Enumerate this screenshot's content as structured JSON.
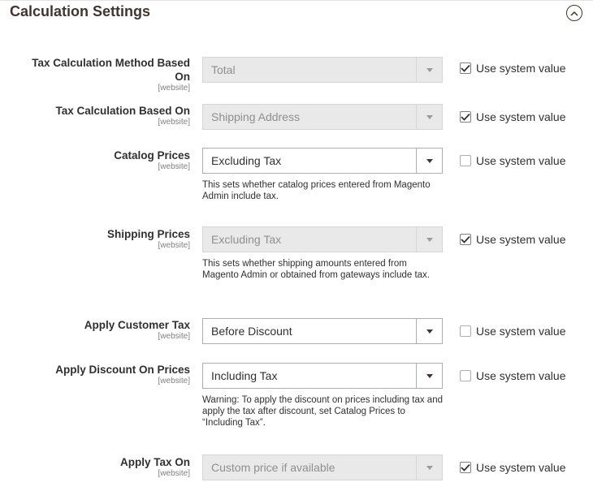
{
  "section": {
    "title": "Calculation Settings"
  },
  "use_system_value_label": "Use system value",
  "fields": [
    {
      "label": "Tax Calculation Method Based",
      "label_line2": "On",
      "scope": "[website]",
      "value": "Total",
      "disabled": true,
      "use_system_value": true,
      "note": ""
    },
    {
      "label": "Tax Calculation Based On",
      "scope": "[website]",
      "value": "Shipping Address",
      "disabled": true,
      "use_system_value": true,
      "note": ""
    },
    {
      "label": "Catalog Prices",
      "scope": "[website]",
      "value": "Excluding Tax",
      "disabled": false,
      "use_system_value": false,
      "note": "This sets whether catalog prices entered from Magento Admin include tax."
    },
    {
      "label": "Shipping Prices",
      "scope": "[website]",
      "value": "Excluding Tax",
      "disabled": true,
      "use_system_value": true,
      "note": "This sets whether shipping amounts entered from Magento Admin or obtained from gateways include tax."
    },
    {
      "label": "Apply Customer Tax",
      "scope": "[website]",
      "value": "Before Discount",
      "disabled": false,
      "use_system_value": false,
      "note": ""
    },
    {
      "label": "Apply Discount On Prices",
      "scope": "[website]",
      "value": "Including Tax",
      "disabled": false,
      "use_system_value": false,
      "note": "Warning: To apply the discount on prices including tax and apply the tax after discount, set Catalog Prices to “Including Tax”."
    },
    {
      "label": "Apply Tax On",
      "scope": "[website]",
      "value": "Custom price if available",
      "disabled": true,
      "use_system_value": true,
      "note": ""
    }
  ]
}
